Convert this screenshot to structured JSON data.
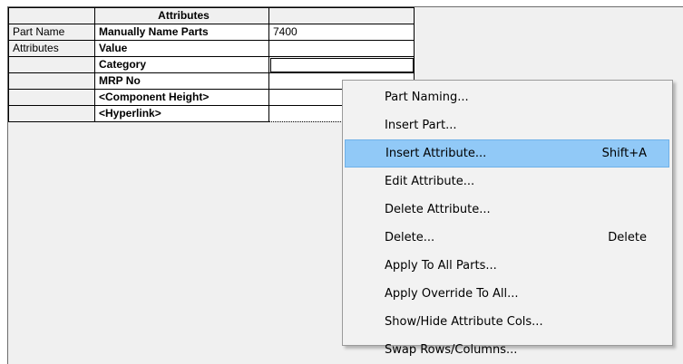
{
  "grid": {
    "header_attributes": "Attributes",
    "rows": [
      {
        "header": "Part Name",
        "name": "Manually Name Parts",
        "value": "7400"
      },
      {
        "header": "Attributes",
        "name": "Value",
        "value": ""
      },
      {
        "header": "",
        "name": "Category",
        "value": ""
      },
      {
        "header": "",
        "name": "MRP No",
        "value": ""
      },
      {
        "header": "",
        "name": "<Component Height>",
        "value": ""
      },
      {
        "header": "",
        "name": "<Hyperlink>",
        "value": ""
      }
    ]
  },
  "context_menu": {
    "items": [
      {
        "label": "Part Naming...",
        "shortcut": ""
      },
      {
        "label": "Insert Part...",
        "shortcut": ""
      },
      {
        "label": "Insert Attribute...",
        "shortcut": "Shift+A",
        "highlighted": true
      },
      {
        "label": "Edit Attribute...",
        "shortcut": ""
      },
      {
        "label": "Delete Attribute...",
        "shortcut": ""
      },
      {
        "label": "Delete...",
        "shortcut": "Delete"
      },
      {
        "label": "Apply To All Parts...",
        "shortcut": ""
      },
      {
        "label": "Apply Override To All...",
        "shortcut": ""
      },
      {
        "label": "Show/Hide Attribute Cols...",
        "shortcut": ""
      },
      {
        "label": "Swap Rows/Columns...",
        "shortcut": ""
      }
    ]
  },
  "colors": {
    "menu_highlight": "#91c9f7",
    "menu_background": "#f2f2f2",
    "grid_background": "#f0f0f0"
  }
}
